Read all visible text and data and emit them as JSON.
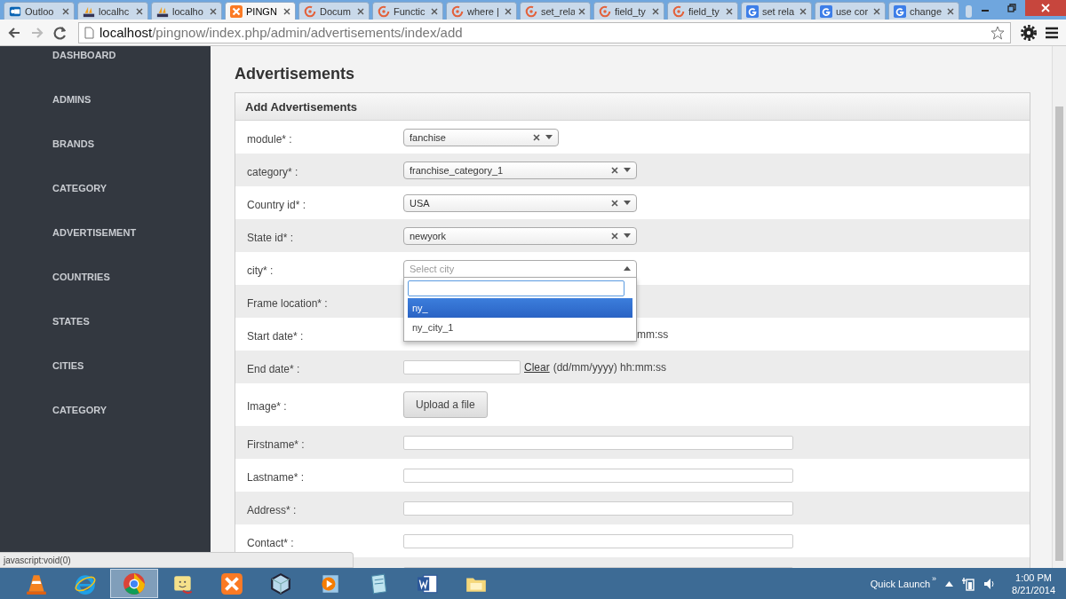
{
  "browser": {
    "tabs": [
      {
        "title": "Outloo",
        "kind": "mail",
        "selected": false
      },
      {
        "title": "localhc",
        "kind": "pma",
        "selected": false
      },
      {
        "title": "localho",
        "kind": "pma",
        "selected": false
      },
      {
        "title": "PINGN",
        "kind": "xampp",
        "selected": true
      },
      {
        "title": "Docum",
        "kind": "swirl",
        "selected": false
      },
      {
        "title": "Functic",
        "kind": "swirl",
        "selected": false
      },
      {
        "title": "where |",
        "kind": "swirl",
        "selected": false
      },
      {
        "title": "set_rela",
        "kind": "swirl",
        "selected": false
      },
      {
        "title": "field_ty",
        "kind": "swirl",
        "selected": false
      },
      {
        "title": "field_ty",
        "kind": "swirl",
        "selected": false
      },
      {
        "title": "set rela",
        "kind": "google",
        "selected": false
      },
      {
        "title": "use cor",
        "kind": "google",
        "selected": false
      },
      {
        "title": "change",
        "kind": "google",
        "selected": false
      }
    ],
    "url_host": "localhost",
    "url_path": "/pingnow/index.php/admin/advertisements/index/add",
    "forward_disabled": true
  },
  "sidebar": {
    "items": [
      {
        "label": "DASHBOARD"
      },
      {
        "label": "ADMINS"
      },
      {
        "label": "BRANDS"
      },
      {
        "label": "CATEGORY"
      },
      {
        "label": "ADVERTISEMENT"
      },
      {
        "label": "COUNTRIES"
      },
      {
        "label": "STATES"
      },
      {
        "label": "CITIES"
      },
      {
        "label": "CATEGORY"
      }
    ]
  },
  "page": {
    "title": "Advertisements",
    "panel_title": "Add Advertisements",
    "rows": [
      {
        "label": "module* :",
        "kind": "select",
        "value": "fanchise"
      },
      {
        "label": "category* :",
        "kind": "select",
        "value": "franchise_category_1"
      },
      {
        "label": "Country id* :",
        "kind": "select",
        "value": "USA"
      },
      {
        "label": "State id* :",
        "kind": "select",
        "value": "newyork"
      },
      {
        "label": "city* :",
        "kind": "select",
        "placeholder": "Select city",
        "expanded": true,
        "options": [
          {
            "label": "ny_",
            "selected": true
          },
          {
            "label": "ny_city_1",
            "selected": false
          }
        ]
      },
      {
        "label": "Frame location* :",
        "kind": "covered"
      },
      {
        "label": "Start date* :",
        "kind": "covered",
        "hint": "mm:ss"
      },
      {
        "label": "End date* :",
        "kind": "date",
        "link": "Clear",
        "hint": "(dd/mm/yyyy) hh:mm:ss"
      },
      {
        "label": "Image* :",
        "kind": "upload",
        "button": "Upload a file"
      },
      {
        "label": "Firstname* :",
        "kind": "text"
      },
      {
        "label": "Lastname* :",
        "kind": "text"
      },
      {
        "label": "Address* :",
        "kind": "text"
      },
      {
        "label": "Contact* :",
        "kind": "text"
      },
      {
        "kind": "text"
      }
    ]
  },
  "status_bar": {
    "text": "javascript:void(0)"
  },
  "taskbar": {
    "apps": [
      {
        "kind": "cone",
        "selected": false
      },
      {
        "kind": "ie",
        "selected": false
      },
      {
        "kind": "chrome",
        "selected": true
      },
      {
        "kind": "folderface",
        "selected": false
      },
      {
        "kind": "xampp",
        "selected": false
      },
      {
        "kind": "cube",
        "selected": false
      },
      {
        "kind": "player",
        "selected": false
      },
      {
        "kind": "notepad",
        "selected": false
      },
      {
        "kind": "word",
        "selected": false
      },
      {
        "kind": "folder",
        "selected": false
      }
    ],
    "quick_launch": "Quick Launch",
    "overflow": "»",
    "time": "1:00 PM",
    "date": "8/21/2014"
  }
}
